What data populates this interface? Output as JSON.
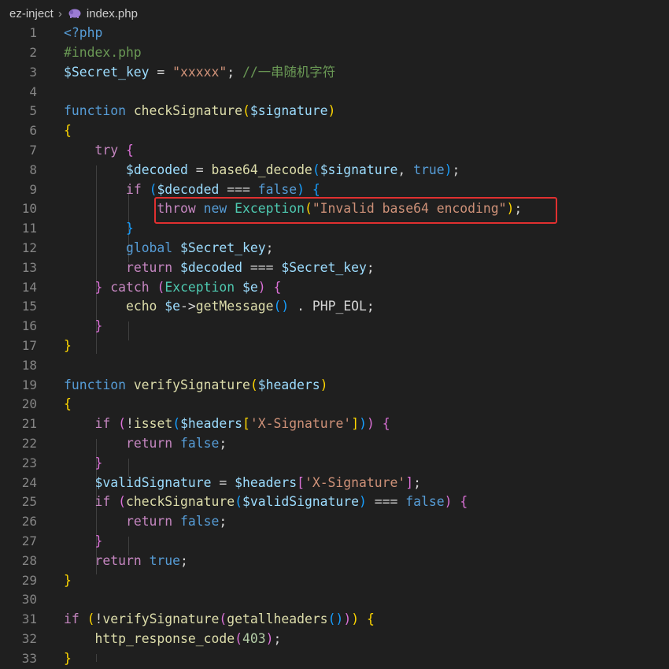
{
  "breadcrumb": {
    "folder": "ez-inject",
    "file": "index.php"
  },
  "icons": {
    "separator": "chevron-right-icon",
    "file": "php-elephant-icon"
  },
  "lines": [
    {
      "n": "1",
      "t": [
        [
          "<?php",
          "kw"
        ]
      ]
    },
    {
      "n": "2",
      "t": [
        [
          "#index.php",
          "com"
        ]
      ]
    },
    {
      "n": "3",
      "t": [
        [
          "$Secret_key",
          "var"
        ],
        [
          " = ",
          "op"
        ],
        [
          "\"xxxxx\"",
          "str"
        ],
        [
          "; ",
          "op"
        ],
        [
          "//一串随机字符",
          "com"
        ]
      ]
    },
    {
      "n": "4",
      "t": []
    },
    {
      "n": "5",
      "t": [
        [
          "function ",
          "kw"
        ],
        [
          "checkSignature",
          "fn"
        ],
        [
          "(",
          "p1"
        ],
        [
          "$signature",
          "var"
        ],
        [
          ")",
          "p1"
        ]
      ]
    },
    {
      "n": "6",
      "t": [
        [
          "{",
          "p1"
        ]
      ]
    },
    {
      "n": "7",
      "t": [
        [
          "    ",
          "op"
        ],
        [
          "try ",
          "ctl"
        ],
        [
          "{",
          "p2"
        ]
      ]
    },
    {
      "n": "8",
      "t": [
        [
          "        ",
          "op"
        ],
        [
          "$decoded",
          "var"
        ],
        [
          " = ",
          "op"
        ],
        [
          "base64_decode",
          "fn"
        ],
        [
          "(",
          "p3"
        ],
        [
          "$signature",
          "var"
        ],
        [
          ", ",
          "op"
        ],
        [
          "true",
          "kw"
        ],
        [
          ")",
          "p3"
        ],
        [
          ";",
          "op"
        ]
      ]
    },
    {
      "n": "9",
      "t": [
        [
          "        ",
          "op"
        ],
        [
          "if ",
          "ctl"
        ],
        [
          "(",
          "p3"
        ],
        [
          "$decoded",
          "var"
        ],
        [
          " === ",
          "op"
        ],
        [
          "false",
          "kw"
        ],
        [
          ") ",
          "p3"
        ],
        [
          "{",
          "p3"
        ]
      ]
    },
    {
      "n": "10",
      "t": [
        [
          "            ",
          "op"
        ],
        [
          "throw ",
          "ctl"
        ],
        [
          "new ",
          "kw"
        ],
        [
          "Exception",
          "cls"
        ],
        [
          "(",
          "p1"
        ],
        [
          "\"Invalid base64 encoding\"",
          "str"
        ],
        [
          ")",
          "p1"
        ],
        [
          ";",
          "op"
        ]
      ]
    },
    {
      "n": "11",
      "t": [
        [
          "        ",
          "op"
        ],
        [
          "}",
          "p3"
        ]
      ]
    },
    {
      "n": "12",
      "t": [
        [
          "        ",
          "op"
        ],
        [
          "global ",
          "kw"
        ],
        [
          "$Secret_key",
          "var"
        ],
        [
          ";",
          "op"
        ]
      ]
    },
    {
      "n": "13",
      "t": [
        [
          "        ",
          "op"
        ],
        [
          "return ",
          "ctl"
        ],
        [
          "$decoded",
          "var"
        ],
        [
          " === ",
          "op"
        ],
        [
          "$Secret_key",
          "var"
        ],
        [
          ";",
          "op"
        ]
      ]
    },
    {
      "n": "14",
      "t": [
        [
          "    ",
          "op"
        ],
        [
          "} ",
          "p2"
        ],
        [
          "catch ",
          "ctl"
        ],
        [
          "(",
          "p2"
        ],
        [
          "Exception ",
          "cls"
        ],
        [
          "$e",
          "var"
        ],
        [
          ") ",
          "p2"
        ],
        [
          "{",
          "p2"
        ]
      ]
    },
    {
      "n": "15",
      "t": [
        [
          "        ",
          "op"
        ],
        [
          "echo ",
          "fn"
        ],
        [
          "$e",
          "var"
        ],
        [
          "->",
          "op"
        ],
        [
          "getMessage",
          "fn"
        ],
        [
          "()",
          "p3"
        ],
        [
          " . ",
          "op"
        ],
        [
          "PHP_EOL",
          "op"
        ],
        [
          ";",
          "op"
        ]
      ]
    },
    {
      "n": "16",
      "t": [
        [
          "    ",
          "op"
        ],
        [
          "}",
          "p2"
        ]
      ]
    },
    {
      "n": "17",
      "t": [
        [
          "}",
          "p1"
        ]
      ]
    },
    {
      "n": "18",
      "t": []
    },
    {
      "n": "19",
      "t": [
        [
          "function ",
          "kw"
        ],
        [
          "verifySignature",
          "fn"
        ],
        [
          "(",
          "p1"
        ],
        [
          "$headers",
          "var"
        ],
        [
          ")",
          "p1"
        ]
      ]
    },
    {
      "n": "20",
      "t": [
        [
          "{",
          "p1"
        ]
      ]
    },
    {
      "n": "21",
      "t": [
        [
          "    ",
          "op"
        ],
        [
          "if ",
          "ctl"
        ],
        [
          "(",
          "p2"
        ],
        [
          "!",
          "op"
        ],
        [
          "isset",
          "fn"
        ],
        [
          "(",
          "p3"
        ],
        [
          "$headers",
          "var"
        ],
        [
          "[",
          "p1"
        ],
        [
          "'X-Signature'",
          "str"
        ],
        [
          "]",
          "p1"
        ],
        [
          ")",
          "p3"
        ],
        [
          ")",
          "p2"
        ],
        [
          " ",
          "op"
        ],
        [
          "{",
          "p2"
        ]
      ]
    },
    {
      "n": "22",
      "t": [
        [
          "        ",
          "op"
        ],
        [
          "return ",
          "ctl"
        ],
        [
          "false",
          "kw"
        ],
        [
          ";",
          "op"
        ]
      ]
    },
    {
      "n": "23",
      "t": [
        [
          "    ",
          "op"
        ],
        [
          "}",
          "p2"
        ]
      ]
    },
    {
      "n": "24",
      "t": [
        [
          "    ",
          "op"
        ],
        [
          "$validSignature",
          "var"
        ],
        [
          " = ",
          "op"
        ],
        [
          "$headers",
          "var"
        ],
        [
          "[",
          "p2"
        ],
        [
          "'X-Signature'",
          "str"
        ],
        [
          "]",
          "p2"
        ],
        [
          ";",
          "op"
        ]
      ]
    },
    {
      "n": "25",
      "t": [
        [
          "    ",
          "op"
        ],
        [
          "if ",
          "ctl"
        ],
        [
          "(",
          "p2"
        ],
        [
          "checkSignature",
          "fn"
        ],
        [
          "(",
          "p3"
        ],
        [
          "$validSignature",
          "var"
        ],
        [
          ")",
          "p3"
        ],
        [
          " === ",
          "op"
        ],
        [
          "false",
          "kw"
        ],
        [
          ") ",
          "p2"
        ],
        [
          "{",
          "p2"
        ]
      ]
    },
    {
      "n": "26",
      "t": [
        [
          "        ",
          "op"
        ],
        [
          "return ",
          "ctl"
        ],
        [
          "false",
          "kw"
        ],
        [
          ";",
          "op"
        ]
      ]
    },
    {
      "n": "27",
      "t": [
        [
          "    ",
          "op"
        ],
        [
          "}",
          "p2"
        ]
      ]
    },
    {
      "n": "28",
      "t": [
        [
          "    ",
          "op"
        ],
        [
          "return ",
          "ctl"
        ],
        [
          "true",
          "kw"
        ],
        [
          ";",
          "op"
        ]
      ]
    },
    {
      "n": "29",
      "t": [
        [
          "}",
          "p1"
        ]
      ]
    },
    {
      "n": "30",
      "t": []
    },
    {
      "n": "31",
      "t": [
        [
          "if ",
          "ctl"
        ],
        [
          "(",
          "p1"
        ],
        [
          "!",
          "op"
        ],
        [
          "verifySignature",
          "fn"
        ],
        [
          "(",
          "p2"
        ],
        [
          "getallheaders",
          "fn"
        ],
        [
          "()",
          "p3"
        ],
        [
          ")",
          "p2"
        ],
        [
          ")",
          "p1"
        ],
        [
          " ",
          "op"
        ],
        [
          "{",
          "p1"
        ]
      ]
    },
    {
      "n": "32",
      "t": [
        [
          "    ",
          "op"
        ],
        [
          "http_response_code",
          "fn"
        ],
        [
          "(",
          "p2"
        ],
        [
          "403",
          "num"
        ],
        [
          ")",
          "p2"
        ],
        [
          ";",
          "op"
        ]
      ]
    },
    {
      "n": "33",
      "t": [
        [
          "}",
          "p1"
        ]
      ]
    }
  ]
}
